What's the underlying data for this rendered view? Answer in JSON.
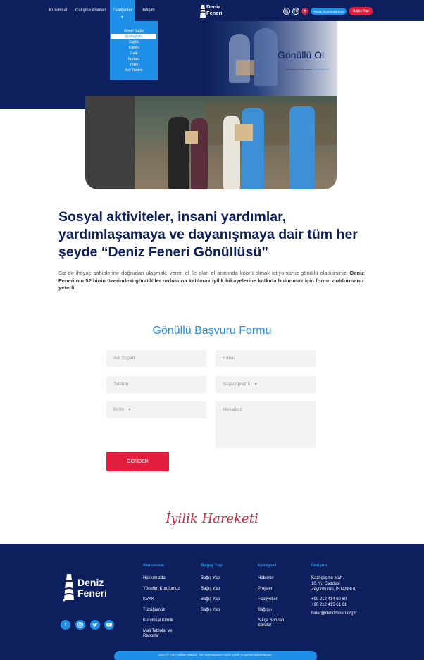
{
  "nav": {
    "items": [
      "Kurumsal",
      "Çalışma Alanları",
      "Faaliyetler",
      "İletişim"
    ],
    "brand": [
      "Deniz",
      "Feneri"
    ],
    "lang": "TR",
    "member_button": "Hesap Numaralarımız",
    "donate_button": "Bağış Yap"
  },
  "dropdown": {
    "items": [
      "Genel Bağış",
      "Su Kuyusu",
      "Sağlık",
      "Eğitim",
      "Gıda",
      "Kurban",
      "Yetim",
      "Acil Yardım"
    ]
  },
  "hero": {
    "title": "Gönüllü Ol",
    "breadcrumb": [
      "Anasayfa",
      "Kurumsal",
      "Gönüllü Ol"
    ]
  },
  "intro": {
    "title": "Sosyal aktiviteler, insani yardımlar, yardımlaşamaya ve dayanışmaya dair tüm her şeyde “Deniz Feneri Gönüllüsü”",
    "text_plain": "Siz de ihtiyaç sahiplerine doğrudan ulaşmak, veren el ile alan el arasında köprü olmak istiyorsanız gönüllü olabilirsiniz.",
    "text_bold": "Deniz Feneri'nin 52 binin üzerindeki gönüllüler ordusuna katılarak iyilik hikayelerine katkıda bulunmak için formu doldurmanız yeterli."
  },
  "form": {
    "title": "Gönüllü Başvuru Formu",
    "name_placeholder": "Ad- Soyad",
    "email_placeholder": "E-mail",
    "phone_placeholder": "Telefon",
    "city_placeholder": "Yaşadığınız İl",
    "unit_placeholder": "Birim",
    "message_placeholder": "Mesajınız",
    "submit": "GÖNDER"
  },
  "signature": "İyilik Hareketi",
  "footer": {
    "brand": [
      "Deniz",
      "Feneri"
    ],
    "columns": [
      {
        "title": "Kurumsal",
        "links": [
          "Hakkımızda",
          "Yönetim Kurulumuz",
          "KVKK",
          "Tüzüğümüz",
          "Kurumsal Kimlik",
          "Mali Tablolar ve Raporlar"
        ]
      },
      {
        "title": "Bağış Yap",
        "links": [
          "Bağış Yap",
          "Bağış Yap",
          "Bağış Yap",
          "Bağış Yap"
        ]
      },
      {
        "title": "Kategori",
        "links": [
          "Haberler",
          "Projeler",
          "Faaliyetler",
          "Bağışçı",
          "Sıkça Sorulan Sorular"
        ]
      },
      {
        "title": "İletişim",
        "address": [
          "Kazlıçeşme Mah.",
          "10. Yıl Caddesi",
          "Zeytinburnu, İSTANBUL"
        ],
        "phones": [
          "+90 212 414 60 60",
          "+90 212 415 61 61"
        ],
        "email": "fener@denizfeneri.org.tr"
      }
    ],
    "copyright": "2021 © Tüm hakları saklıdır. İzin alınmaksızın hiçbir içerik ve görsel kullanılamaz."
  },
  "colors": {
    "navy": "#0d1f5c",
    "accent": "#1e90e8",
    "red": "#e41e3f"
  }
}
